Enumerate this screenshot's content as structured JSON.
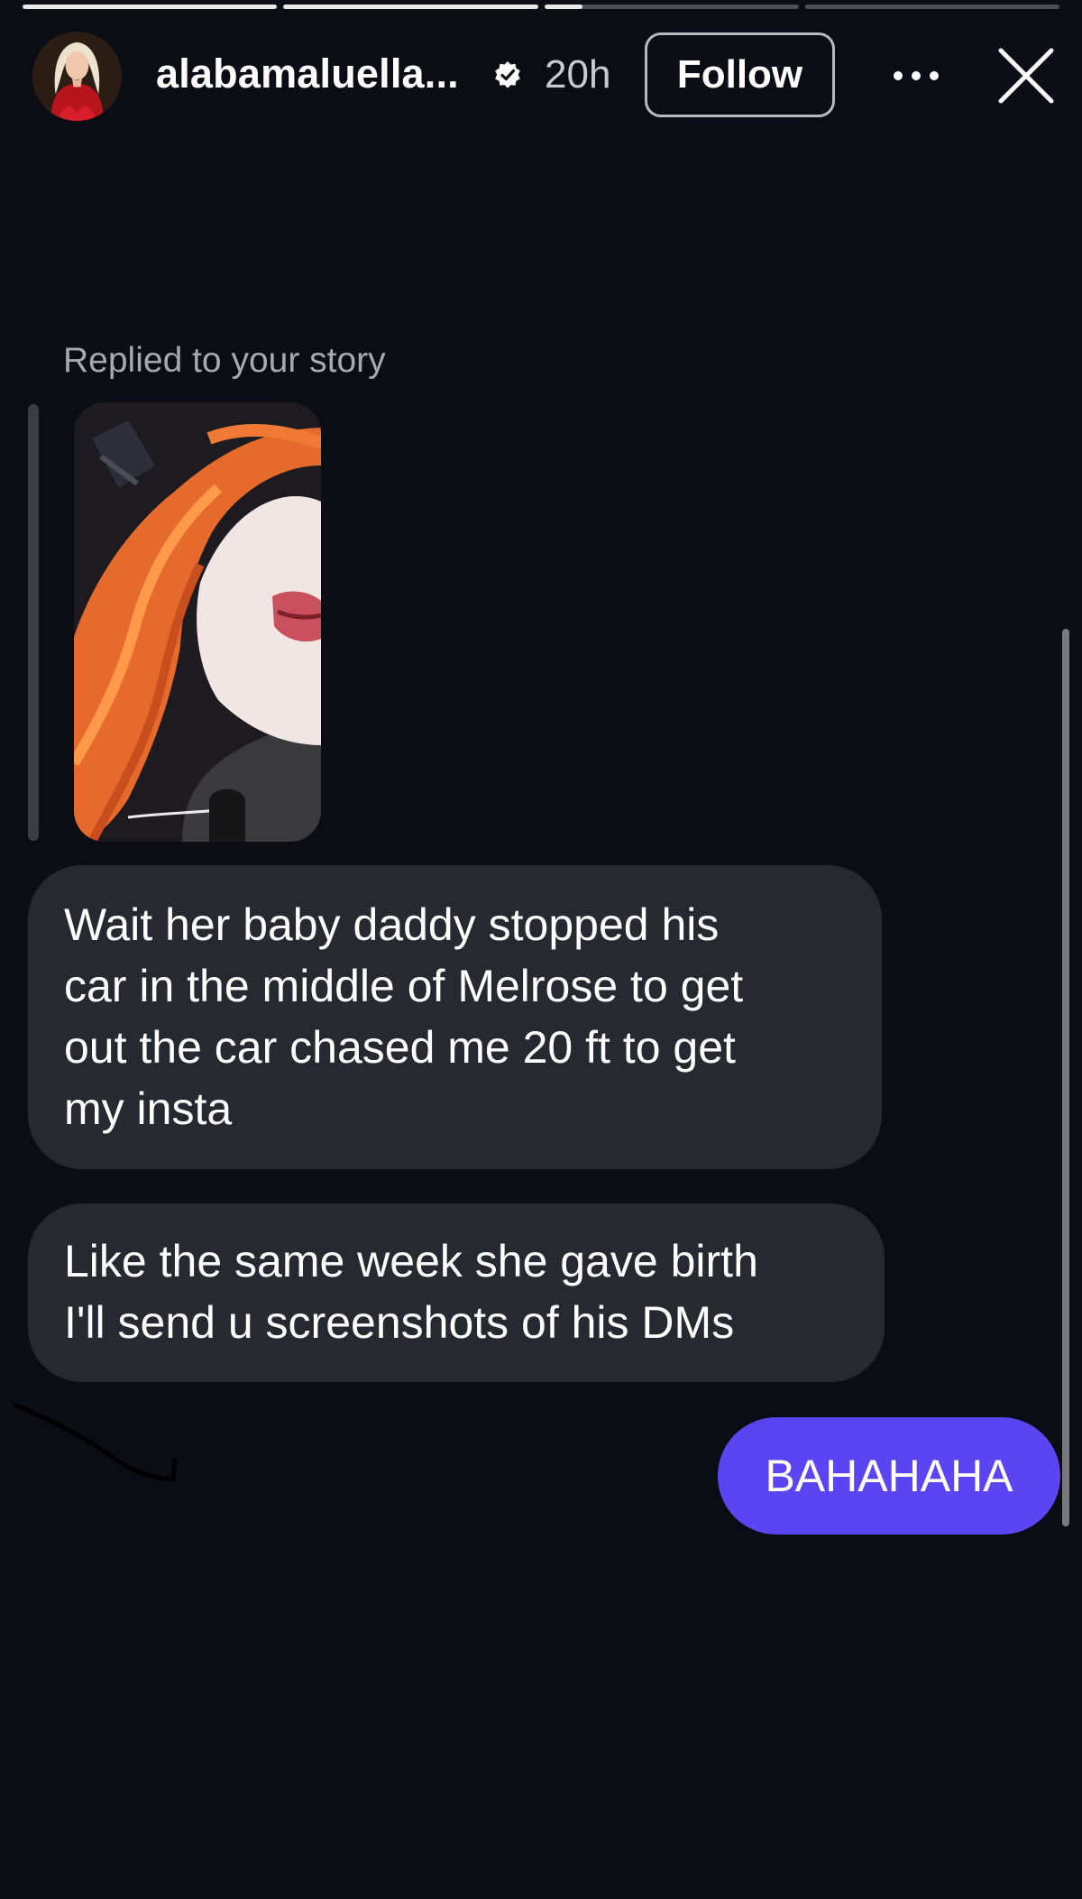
{
  "story_progress": {
    "segments": [
      1.0,
      1.0,
      0.15,
      0.0
    ]
  },
  "header": {
    "username": "alabamaluella...",
    "verified_icon": "verified-badge-icon",
    "timestamp": "20h",
    "follow_label": "Follow",
    "more_icon": "more-options-icon",
    "close_icon": "close-icon"
  },
  "conversation": {
    "reply_label": "Replied to your story",
    "messages": [
      {
        "sender": "them",
        "lines": [
          "Wait her baby daddy stopped his",
          "car in the middle of Melrose to get",
          "out the car chased me 20 ft to get",
          "my insta"
        ]
      },
      {
        "sender": "them",
        "lines": [
          "Like the same week she gave birth",
          "I'll send u screenshots of his DMs"
        ]
      },
      {
        "sender": "me",
        "text": "BAHAHAHA"
      }
    ]
  },
  "colors": {
    "background": "#0b0d14",
    "incoming_bubble": "#262930",
    "outgoing_bubble": "#5b45f2",
    "muted_text": "#a8a9ad"
  }
}
